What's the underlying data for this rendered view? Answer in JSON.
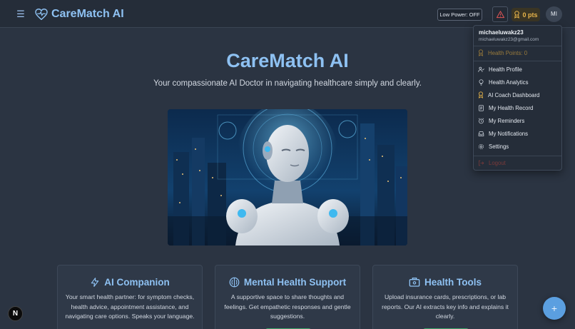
{
  "header": {
    "brand_title": "CareMatch AI",
    "low_power_label": "Low Power: OFF",
    "points_label": "0 pts",
    "avatar_initials": "MI",
    "brand_color": "#8ec1f2",
    "alert_color": "#e25555",
    "points_color": "#e9b54a"
  },
  "hero": {
    "title": "CareMatch AI",
    "subtitle": "Your compassionate AI Doctor in navigating healthcare simply and clearly."
  },
  "cards": [
    {
      "title": "AI Companion",
      "icon": "lightning-icon",
      "text": "Your smart health partner: for symptom checks, health advice, appointment assistance, and navigating care options. Speaks your language."
    },
    {
      "title": "Mental Health Support",
      "icon": "brain-icon",
      "text": "A supportive space to share thoughts and feelings. Get empathetic responses and gentle suggestions."
    },
    {
      "title": "Health Tools",
      "icon": "briefcase-icon",
      "text": "Upload insurance cards, prescriptions, or lab reports. Our AI extracts key info and explains it clearly."
    }
  ],
  "dropdown": {
    "username": "michaeluwakz23",
    "email": "michaeluwakz23@gmail.com",
    "points": "Health Points: 0",
    "items": [
      {
        "label": "Health Profile",
        "icon": "user-profile-icon"
      },
      {
        "label": "Health Analytics",
        "icon": "lightbulb-icon"
      },
      {
        "label": "AI Coach Dashboard",
        "icon": "award-icon"
      },
      {
        "label": "My Health Record",
        "icon": "document-icon"
      },
      {
        "label": "My Reminders",
        "icon": "alarm-icon"
      },
      {
        "label": "My Notifications",
        "icon": "inbox-icon"
      },
      {
        "label": "Settings",
        "icon": "gear-icon"
      }
    ],
    "logout": "Logout"
  },
  "fab_label": "+",
  "n_badge_label": "N"
}
